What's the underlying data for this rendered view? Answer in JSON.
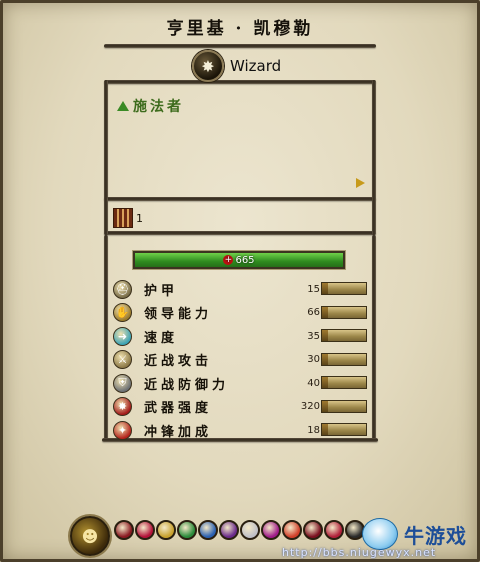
{
  "title": "亨里基 · 凯穆勒",
  "class": {
    "icon": "wizard-class-icon",
    "name": "Wizard"
  },
  "ability": {
    "label": "施法者",
    "next_icon": "arrow-right-icon"
  },
  "unit": {
    "icon": "unit-count-icon",
    "count": "1"
  },
  "hp": {
    "value": "665",
    "icon": "health-cross-icon",
    "fill_percent": 100,
    "color": "#3fae2c"
  },
  "stats": [
    {
      "label": "护甲",
      "value": "15",
      "icon": "armour-icon",
      "color": "#7a6e4a"
    },
    {
      "label": "领导能力",
      "value": "66",
      "icon": "leadership-icon",
      "color": "#9a7a2a"
    },
    {
      "label": "速度",
      "value": "35",
      "icon": "speed-icon",
      "color": "#3aa3b5"
    },
    {
      "label": "近战攻击",
      "value": "30",
      "icon": "melee-attack-icon",
      "color": "#8d7a48"
    },
    {
      "label": "近战防御力",
      "value": "40",
      "icon": "melee-defence-icon",
      "color": "#6b6f73"
    },
    {
      "label": "武器强度",
      "value": "320",
      "icon": "weapon-strength-icon",
      "color": "#a31a1a"
    },
    {
      "label": "冲锋加成",
      "value": "18",
      "icon": "charge-bonus-icon",
      "color": "#b2211a"
    }
  ],
  "bottom": {
    "captain_icon": "captain-portrait-icon",
    "spells": [
      {
        "icon": "spell-icon-1",
        "color": "#8a1a22"
      },
      {
        "icon": "spell-icon-2",
        "color": "#b3123a"
      },
      {
        "icon": "spell-icon-3",
        "color": "#c8a12e"
      },
      {
        "icon": "spell-icon-4",
        "color": "#2a8a3a"
      },
      {
        "icon": "spell-icon-5",
        "color": "#2a60b0"
      },
      {
        "icon": "spell-icon-6",
        "color": "#6a2a8a"
      },
      {
        "icon": "spell-icon-7",
        "color": "#c0c0c8"
      },
      {
        "icon": "spell-icon-8",
        "color": "#a01c8a"
      },
      {
        "icon": "spell-icon-9",
        "color": "#d0402a"
      },
      {
        "icon": "spell-icon-10",
        "color": "#7a1020"
      },
      {
        "icon": "spell-icon-11",
        "color": "#b0203a"
      },
      {
        "icon": "spell-icon-12",
        "color": "#2a2a2a"
      }
    ],
    "watermark": {
      "name": "牛游戏",
      "url": "http://bbs.niugewyx.net"
    }
  }
}
